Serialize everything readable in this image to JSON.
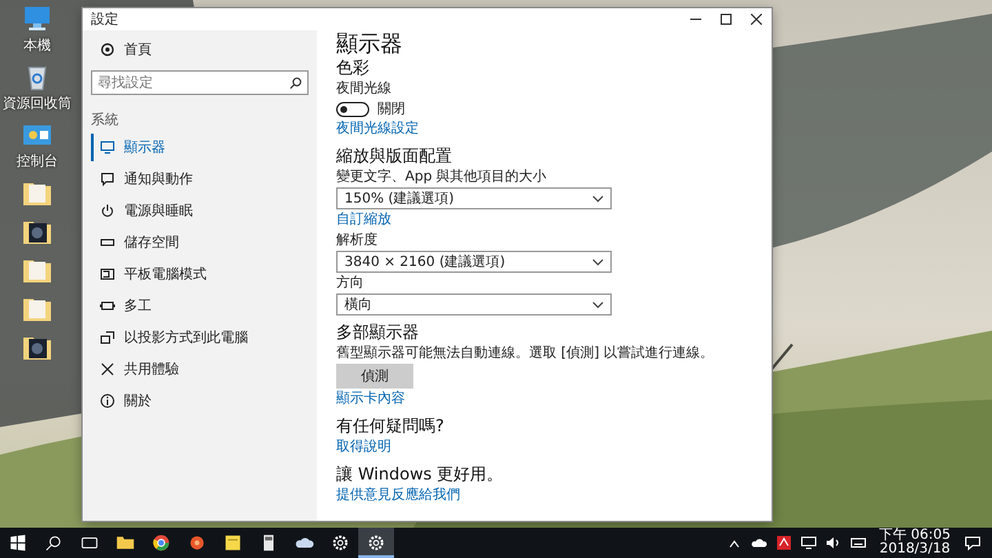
{
  "desktop_icons": [
    {
      "kind": "pc",
      "label": "本機"
    },
    {
      "kind": "recycle",
      "label": "資源回收筒"
    },
    {
      "kind": "panel",
      "label": "控制台"
    },
    {
      "kind": "folder"
    },
    {
      "kind": "folder-dark"
    },
    {
      "kind": "folder"
    },
    {
      "kind": "folder"
    },
    {
      "kind": "folder-dark"
    }
  ],
  "window": {
    "title": "設定"
  },
  "sidebar": {
    "home": "首頁",
    "search": {
      "placeholder": "尋找設定"
    },
    "section": "系統",
    "items": [
      {
        "label": "顯示器",
        "selected": true
      },
      {
        "label": "通知與動作",
        "selected": false
      },
      {
        "label": "電源與睡眠",
        "selected": false
      },
      {
        "label": "儲存空間",
        "selected": false
      },
      {
        "label": "平板電腦模式",
        "selected": false
      },
      {
        "label": "多工",
        "selected": false
      },
      {
        "label": "以投影方式到此電腦",
        "selected": false
      },
      {
        "label": "共用體驗",
        "selected": false
      },
      {
        "label": "關於",
        "selected": false
      }
    ]
  },
  "content": [
    {
      "kind": "title",
      "text": "顯示器"
    },
    {
      "kind": "heading",
      "text": "色彩"
    },
    {
      "kind": "label",
      "text": "夜間光線"
    },
    {
      "kind": "toggle",
      "on": false,
      "text": "關閉"
    },
    {
      "kind": "link",
      "text": "夜間光線設定"
    },
    {
      "kind": "section",
      "text": "縮放與版面配置"
    },
    {
      "kind": "label",
      "text": "變更文字、App 與其他項目的大小"
    },
    {
      "kind": "dropdown",
      "text": "150% (建議選項)"
    },
    {
      "kind": "link",
      "text": "自訂縮放"
    },
    {
      "kind": "label",
      "text": "解析度"
    },
    {
      "kind": "dropdown",
      "text": "3840 × 2160 (建議選項)"
    },
    {
      "kind": "label",
      "text": "方向"
    },
    {
      "kind": "dropdown",
      "text": "橫向"
    },
    {
      "kind": "section",
      "text": "多部顯示器"
    },
    {
      "kind": "label",
      "text": "舊型顯示器可能無法自動連線。選取 [偵測] 以嘗試進行連線。"
    },
    {
      "kind": "button",
      "text": "偵測"
    },
    {
      "kind": "link",
      "text": "顯示卡內容"
    },
    {
      "kind": "section",
      "text": "有任何疑問嗎?"
    },
    {
      "kind": "link",
      "text": "取得說明"
    },
    {
      "kind": "section",
      "text": "讓 Windows 更好用。"
    },
    {
      "kind": "link",
      "text": "提供意見反應給我們"
    }
  ],
  "taskbar": {
    "apps": [
      {
        "kind": "start",
        "selected": false
      },
      {
        "kind": "search",
        "selected": false
      },
      {
        "kind": "taskview",
        "selected": false
      },
      {
        "kind": "explorer",
        "selected": false
      },
      {
        "kind": "chrome",
        "selected": false
      },
      {
        "kind": "disc",
        "selected": false
      },
      {
        "kind": "notes",
        "selected": false
      },
      {
        "kind": "calculator",
        "selected": false
      },
      {
        "kind": "cloud",
        "selected": false
      },
      {
        "kind": "settings",
        "selected": false
      },
      {
        "kind": "settings",
        "selected": true
      }
    ],
    "clock": {
      "time": "下午 06:05",
      "date": "2018/3/18"
    }
  }
}
